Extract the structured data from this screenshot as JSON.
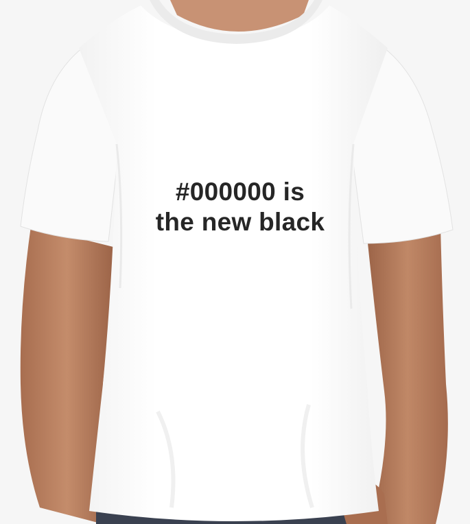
{
  "photo": {
    "subject": "product-photo",
    "colors": {
      "background": "#f6f6f6",
      "shirt": "#ffffff",
      "shirt_shadow": "#ececec",
      "skin": "#b98263",
      "skin_dark": "#9c6448",
      "jeans": "#3a4150",
      "print_ink": "#262626"
    }
  },
  "shirt_print": {
    "line1": "#000000 is",
    "line2": "the new black"
  }
}
